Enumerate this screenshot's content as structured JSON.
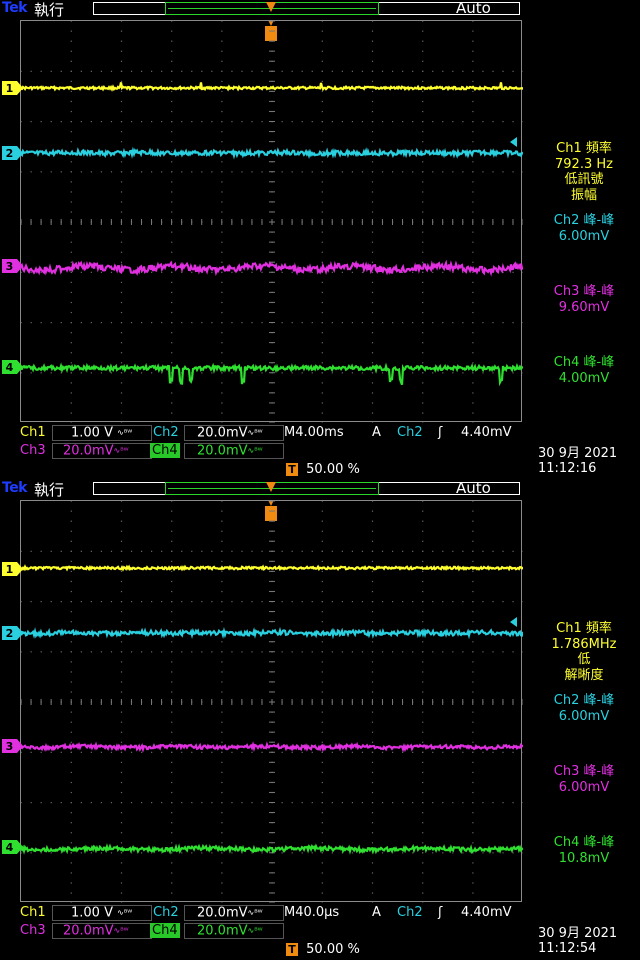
{
  "colors": {
    "ch1": "#ffff30",
    "ch2": "#2ad0e0",
    "ch3": "#e030e0",
    "ch4": "#30e030",
    "trigger": "#f08a10",
    "brand": "#1e3cff"
  },
  "screens": [
    {
      "brand": "Tek",
      "run_status": "執行",
      "acq_mode": "Auto",
      "trigger_marker": "T",
      "channel_markers": [
        "1",
        "2",
        "3",
        "4"
      ],
      "measurements": [
        {
          "lines": [
            "Ch1 頻率",
            "792.3 Hz",
            "低訊號",
            "振幅"
          ],
          "color_key": "ch1"
        },
        {
          "lines": [
            "Ch2 峰-峰",
            "6.00mV"
          ],
          "color_key": "ch2"
        },
        {
          "lines": [
            "Ch3 峰-峰",
            "9.60mV"
          ],
          "color_key": "ch3"
        },
        {
          "lines": [
            "Ch4 峰-峰",
            "4.00mV"
          ],
          "color_key": "ch4"
        }
      ],
      "status": {
        "ch1_label": "Ch1",
        "ch1_scale": "1.00 V",
        "ch2_label": "Ch2",
        "ch2_scale": "20.0mV",
        "ch3_label": "Ch3",
        "ch3_scale": "20.0mV",
        "ch4_label": "Ch4",
        "ch4_scale": "20.0mV",
        "timebase": "M4.00ms",
        "trigger_type": "A",
        "trigger_source": "Ch2",
        "trigger_slope": "ʃ",
        "trigger_level": "4.40mV",
        "trigger_position": "50.00 %",
        "date": "30 9月  2021",
        "time": "11:12:16"
      },
      "waveforms": {
        "ch3_ripple": 1.0,
        "ch4_spikes": true
      }
    },
    {
      "brand": "Tek",
      "run_status": "執行",
      "acq_mode": "Auto",
      "trigger_marker": "T",
      "channel_markers": [
        "1",
        "2",
        "3",
        "4"
      ],
      "measurements": [
        {
          "lines": [
            "Ch1 頻率",
            "1.786MHz",
            "低",
            "解晰度"
          ],
          "color_key": "ch1"
        },
        {
          "lines": [
            "Ch2 峰-峰",
            "6.00mV"
          ],
          "color_key": "ch2"
        },
        {
          "lines": [
            "Ch3 峰-峰",
            "6.00mV"
          ],
          "color_key": "ch3"
        },
        {
          "lines": [
            "Ch4 峰-峰",
            "10.8mV"
          ],
          "color_key": "ch4"
        }
      ],
      "status": {
        "ch1_label": "Ch1",
        "ch1_scale": "1.00 V",
        "ch2_label": "Ch2",
        "ch2_scale": "20.0mV",
        "ch3_label": "Ch3",
        "ch3_scale": "20.0mV",
        "ch4_label": "Ch4",
        "ch4_scale": "20.0mV",
        "timebase": "M40.0µs",
        "trigger_type": "A",
        "trigger_source": "Ch2",
        "trigger_slope": "ʃ",
        "trigger_level": "4.40mV",
        "trigger_position": "50.00 %",
        "date": "30 9月  2021",
        "time": "11:12:54"
      },
      "waveforms": {
        "ch3_ripple": 0.3,
        "ch4_spikes": false
      }
    }
  ]
}
